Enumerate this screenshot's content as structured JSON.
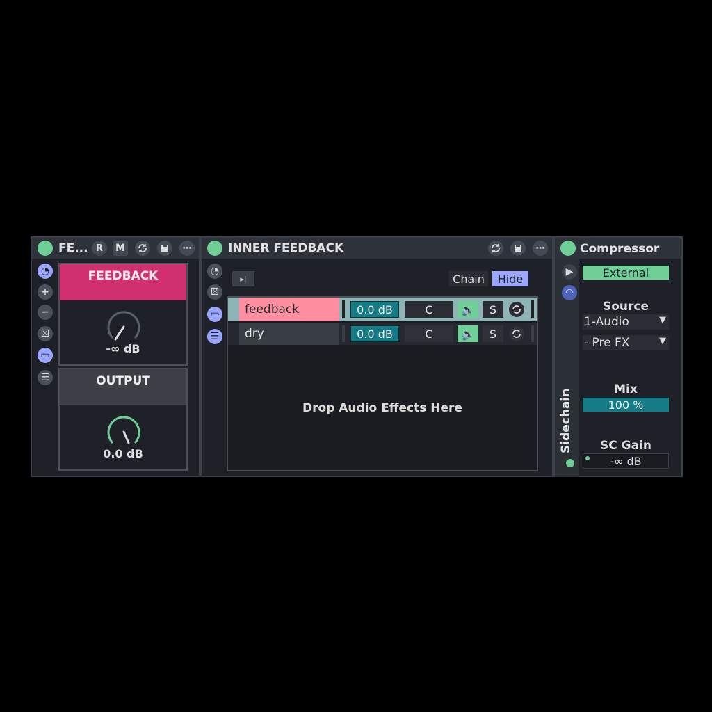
{
  "colors": {
    "accent_green": "#6fcf97",
    "feedback_pink": "#d0306e",
    "chain_pink": "#ff8fa0",
    "teal": "#157c86",
    "blue_icon": "#9aa6ff"
  },
  "device1": {
    "title": "FE...",
    "r_label": "R",
    "m_label": "M",
    "macros": [
      {
        "label": "FEEDBACK",
        "value": "-∞ dB"
      },
      {
        "label": "OUTPUT",
        "value": "0.0 dB"
      }
    ]
  },
  "device2": {
    "title": "INNER FEEDBACK",
    "chain_label": "Chain",
    "hide_label": "Hide",
    "chains": [
      {
        "name": "feedback",
        "volume": "0.0 dB",
        "pan": "C",
        "solo": "S"
      },
      {
        "name": "dry",
        "volume": "0.0 dB",
        "pan": "C",
        "solo": "S"
      }
    ],
    "drop_text": "Drop Audio Effects Here"
  },
  "device3": {
    "title": "Compressor",
    "external_label": "External",
    "source_label": "Source",
    "source_value": "1-Audio",
    "prefx_value": "- Pre FX",
    "mix_label": "Mix",
    "mix_value": "100 %",
    "scgain_label": "SC Gain",
    "scgain_value": "-∞ dB",
    "sidechain_label": "Sidechain"
  }
}
